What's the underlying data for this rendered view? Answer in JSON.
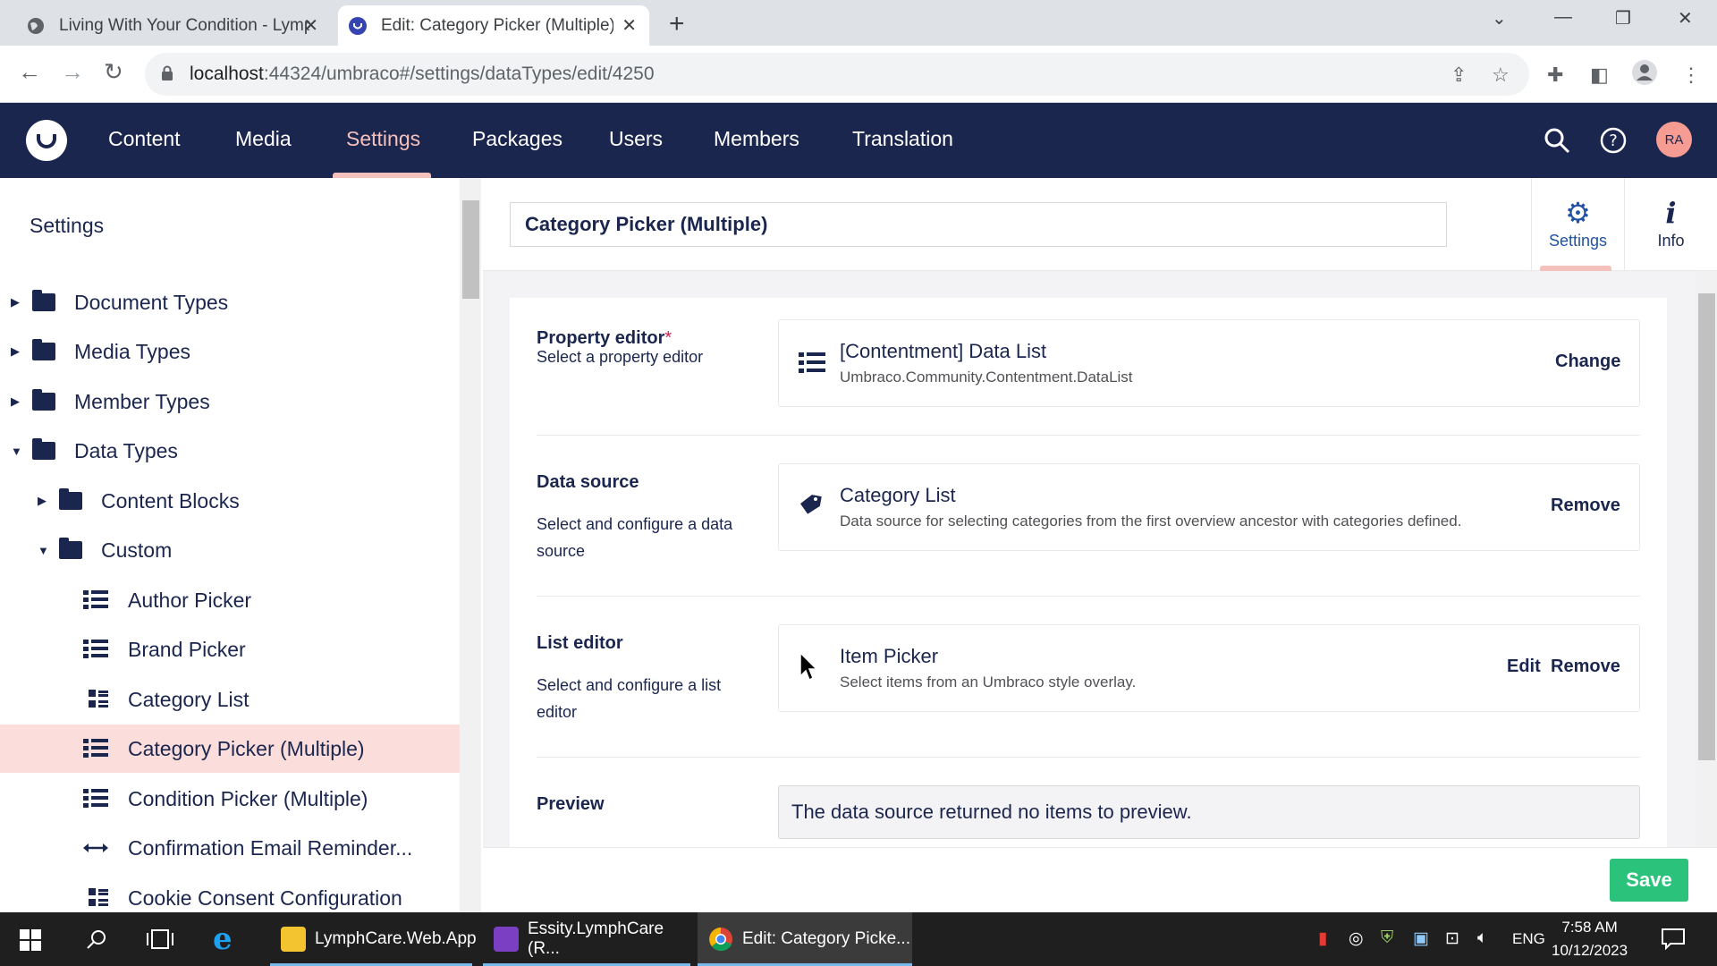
{
  "browser": {
    "tabs": [
      {
        "title": "Living With Your Condition - Lymph"
      },
      {
        "title": "Edit: Category Picker (Multiple) -"
      }
    ],
    "url_host": "localhost",
    "url_rest": ":44324/umbraco#/settings/dataTypes/edit/4250"
  },
  "header": {
    "nav": [
      "Content",
      "Media",
      "Settings",
      "Packages",
      "Users",
      "Members",
      "Translation"
    ],
    "active_nav": "Settings",
    "avatar_initials": "RA"
  },
  "sidebar": {
    "title": "Settings",
    "tree": [
      {
        "label": "Document Types",
        "kind": "folder",
        "caret": "collapsed"
      },
      {
        "label": "Media Types",
        "kind": "folder",
        "caret": "collapsed"
      },
      {
        "label": "Member Types",
        "kind": "folder",
        "caret": "collapsed"
      },
      {
        "label": "Data Types",
        "kind": "folder",
        "caret": "expanded"
      },
      {
        "label": "Content Blocks",
        "kind": "folder",
        "caret": "collapsed"
      },
      {
        "label": "Custom",
        "kind": "folder",
        "caret": "expanded"
      },
      {
        "label": "Author Picker",
        "kind": "list-icon"
      },
      {
        "label": "Brand Picker",
        "kind": "list-icon"
      },
      {
        "label": "Category List",
        "kind": "grid-icon"
      },
      {
        "label": "Category Picker (Multiple)",
        "kind": "list-icon",
        "selected": true
      },
      {
        "label": "Condition Picker (Multiple)",
        "kind": "list-icon"
      },
      {
        "label": "Confirmation Email Reminder...",
        "kind": "arrows-icon"
      },
      {
        "label": "Cookie Consent Configuration",
        "kind": "grid-icon"
      }
    ]
  },
  "editor": {
    "name": "Category Picker (Multiple)",
    "apps": [
      {
        "label": "Settings",
        "icon": "gear-icon",
        "active": true
      },
      {
        "label": "Info",
        "icon": "info-icon",
        "active": false
      }
    ],
    "properties": {
      "property_editor": {
        "label": "Property editor",
        "required_mark": "*",
        "description": "Select a property editor",
        "value_name": "[Contentment] Data List",
        "value_desc": "Umbraco.Community.Contentment.DataList",
        "action": "Change"
      },
      "data_source": {
        "label": "Data source",
        "description": "Select and configure a data source",
        "value_name": "Category List",
        "value_desc": "Data source for selecting categories from the first overview ancestor with categories defined.",
        "action": "Remove"
      },
      "list_editor": {
        "label": "List editor",
        "description": "Select and configure a list editor",
        "value_name": "Item Picker",
        "value_desc": "Select items from an Umbraco style overlay.",
        "action_edit": "Edit",
        "action_remove": "Remove"
      },
      "preview": {
        "label": "Preview",
        "text": "The data source returned no items to preview."
      }
    },
    "save_label": "Save"
  },
  "taskbar": {
    "apps": [
      {
        "label": "LymphCare.Web.App"
      },
      {
        "label": "Essity.LymphCare (R..."
      },
      {
        "label": "Edit: Category Picke..."
      }
    ],
    "lang": "ENG",
    "time": "7:58 AM",
    "date": "10/12/2023"
  },
  "colors": {
    "header_bg": "#1b264f",
    "accent_pink": "#f5c1bc",
    "selected_row": "#fbdedb",
    "save_green": "#2bc37c",
    "app_active_blue": "#2152a3"
  }
}
